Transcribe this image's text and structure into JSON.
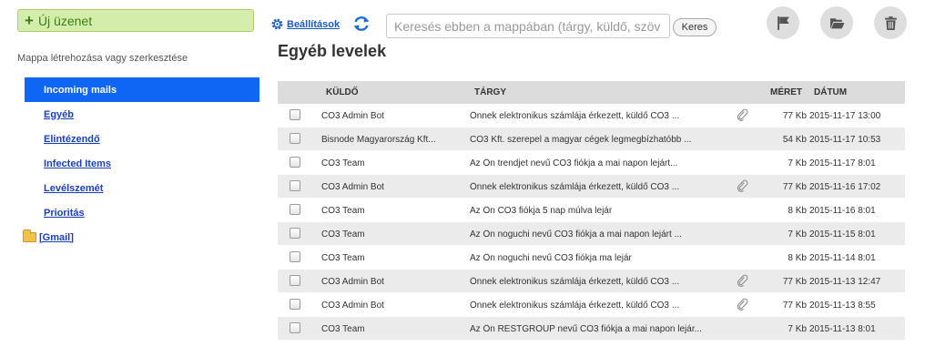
{
  "sidebar": {
    "new_message_icon": "plus-icon",
    "new_message_label": "Új üzenet",
    "folder_hint": "Mappa létrehozása vagy szerkesztése",
    "folders": [
      {
        "label": "Incoming mails",
        "active": true
      },
      {
        "label": "Egyéb"
      },
      {
        "label": "Elintézendő"
      },
      {
        "label": "Infected Items"
      },
      {
        "label": "Levélszemét"
      },
      {
        "label": "Prioritás"
      },
      {
        "label": "[Gmail]",
        "icon": "folder-icon"
      }
    ]
  },
  "toolbar": {
    "settings_label": "Beállítások",
    "search_placeholder": "Keresés ebben a mappában (tárgy, küldő, szöv",
    "search_button": "Keres",
    "icons": [
      "gear-icon",
      "refresh-icon",
      "flag-icon",
      "folder-open-icon",
      "trash-icon"
    ]
  },
  "main": {
    "title": "Egyéb levelek",
    "columns": {
      "sender": "KÜLDŐ",
      "subject": "TÁRGY",
      "size": "MÉRET",
      "date": "DÁTUM"
    },
    "messages": [
      {
        "sender": "CO3 Admin Bot",
        "subject": "Önnek elektronikus számlája érkezett, küldő CO3 ...",
        "attachment": true,
        "size": "77 Kb",
        "date": "2015-11-17 13:00"
      },
      {
        "sender": "Bisnode Magyarország Kft...",
        "subject": "CO3 Kft. szerepel a magyar cégek legmegbízhatóbb ...",
        "attachment": false,
        "size": "54 Kb",
        "date": "2015-11-17 10:53"
      },
      {
        "sender": "CO3 Team",
        "subject": "Az Ön trendjet nevű CO3 fiókja a mai napon lejárt...",
        "attachment": false,
        "size": "7 Kb",
        "date": "2015-11-17 8:01"
      },
      {
        "sender": "CO3 Admin Bot",
        "subject": "Önnek elektronikus számlája érkezett, küldő CO3 ...",
        "attachment": true,
        "size": "77 Kb",
        "date": "2015-11-16 17:02"
      },
      {
        "sender": "CO3 Team",
        "subject": "Az Ön CO3 fiókja 5 nap múlva lejár",
        "attachment": false,
        "size": "8 Kb",
        "date": "2015-11-16 8:01"
      },
      {
        "sender": "CO3 Team",
        "subject": "Az Ön noguchi nevű CO3 fiókja a mai napon lejárt ...",
        "attachment": false,
        "size": "7 Kb",
        "date": "2015-11-15 8:01"
      },
      {
        "sender": "CO3 Team",
        "subject": "Az Ön noguchi nevű CO3 fiókja ma lejár",
        "attachment": false,
        "size": "8 Kb",
        "date": "2015-11-14 8:01"
      },
      {
        "sender": "CO3 Admin Bot",
        "subject": "Önnek elektronikus számlája érkezett, küldő CO3 ...",
        "attachment": true,
        "size": "77 Kb",
        "date": "2015-11-13 12:47"
      },
      {
        "sender": "CO3 Admin Bot",
        "subject": "Önnek elektronikus számlája érkezett, küldő CO3 ...",
        "attachment": true,
        "size": "77 Kb",
        "date": "2015-11-13 8:55"
      },
      {
        "sender": "CO3 Team",
        "subject": "Az Ön RESTGROUP nevű CO3 fiókja a mai napon lejár...",
        "attachment": false,
        "size": "7 Kb",
        "date": "2015-11-13 8:01"
      }
    ]
  }
}
